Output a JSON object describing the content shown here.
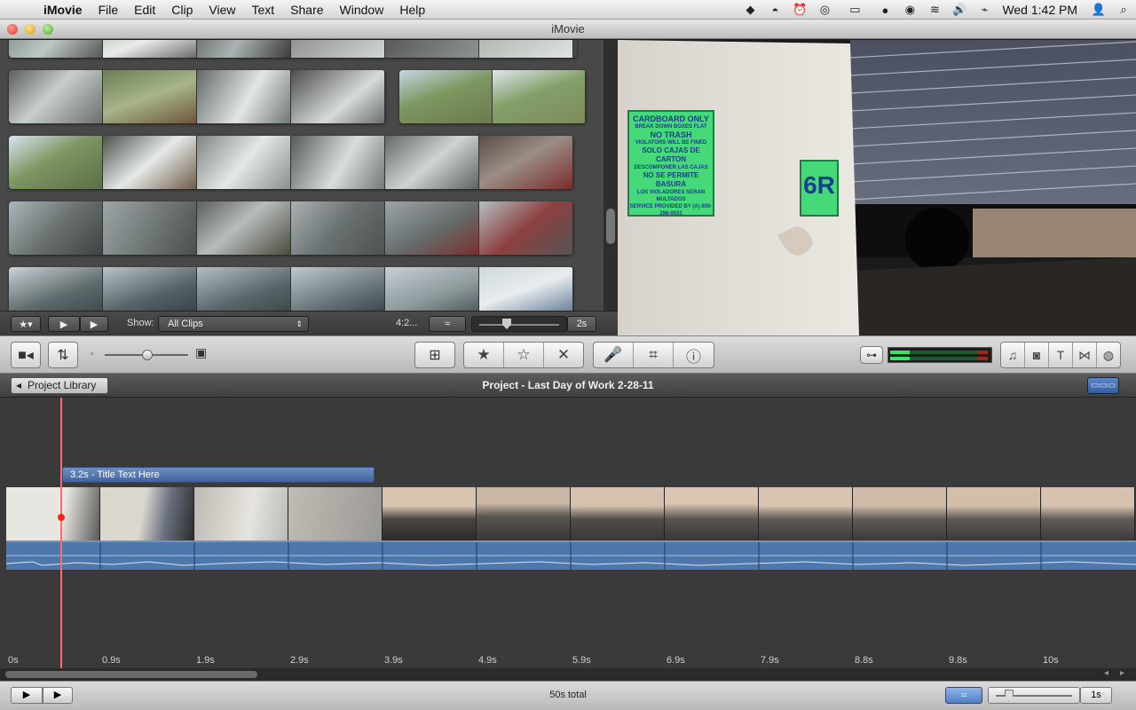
{
  "menubar": {
    "apple_icon": "apple-logo-icon",
    "app_name": "iMovie",
    "items": [
      "File",
      "Edit",
      "Clip",
      "View",
      "Text",
      "Share",
      "Window",
      "Help"
    ],
    "status_icons": [
      "dropbox-icon",
      "bell-icon",
      "alarm-clock-icon",
      "record-icon",
      "battery-outline-icon",
      "bluetooth-icon",
      "wifi-icon",
      "volume-icon",
      "charging-icon"
    ],
    "clock": "Wed 1:42 PM"
  },
  "window": {
    "title": "iMovie"
  },
  "browser_bar": {
    "show_label": "Show:",
    "show_value": "All Clips",
    "aspect_label": "4:2...",
    "duration_label": "2s"
  },
  "viewer": {
    "sign_lines": [
      "CARDBOARD ONLY",
      "BREAK DOWN BOXES FLAT",
      "NO TRASH",
      "VIOLATORS WILL BE FINED",
      "SOLO CAJAS DE CARTON",
      "DESCOMPONER LAS CAJAS",
      "NO SE PERMITE BASURA",
      "LOS VIOLADORES SERAN MULTADOS",
      "SERVICE PROVIDED BY (A) 800-298-0031"
    ],
    "door_label": "6R"
  },
  "toolbar": {
    "icons": {
      "camera": "video-camera-icon",
      "swap": "swap-arrows-icon",
      "small_thumb": "small-thumbnail-icon",
      "large_thumb": "large-thumbnail-icon",
      "add_to_project": "add-to-project-icon",
      "favorite": "filled-star-icon",
      "unmark": "outline-star-icon",
      "reject": "reject-x-icon",
      "voiceover": "microphone-icon",
      "crop": "crop-icon",
      "info": "info-icon",
      "audio_skim": "audio-skim-icon",
      "music": "music-note-icon",
      "photo": "camera-icon",
      "titles": "text-title-icon",
      "transitions": "transitions-icon",
      "maps": "globe-icon"
    },
    "thumb_slider": 0.5
  },
  "project": {
    "library_button": "Project Library",
    "title": "Project - Last Day of Work 2-28-11",
    "title_clip": "3.2s - Title Text Here",
    "ticks": [
      "0s",
      "0.9s",
      "1.9s",
      "2.9s",
      "3.9s",
      "4.9s",
      "5.9s",
      "6.9s",
      "7.9s",
      "8.8s",
      "9.8s",
      "10s"
    ],
    "total": "50s total",
    "zoom_label": "1s"
  },
  "colors": {
    "accent_blue": "#4e78ac",
    "playhead": "#ff6a6a"
  }
}
